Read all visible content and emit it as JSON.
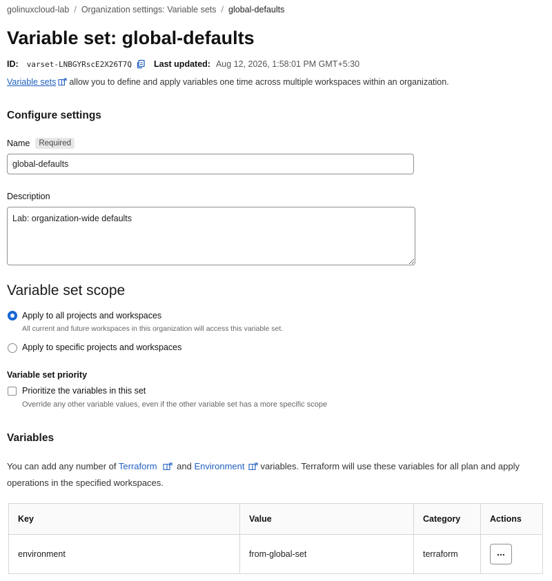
{
  "breadcrumb": {
    "items": [
      "golinuxcloud-lab",
      "Organization settings: Variable sets",
      "global-defaults"
    ]
  },
  "page": {
    "title": "Variable set: global-defaults",
    "id_label": "ID:",
    "id_value": "varset-LNBGYRscE2X26T7Q",
    "updated_label": "Last updated:",
    "updated_value": "Aug 12, 2026, 1:58:01 PM GMT+5:30",
    "intro_link": "Variable sets",
    "intro_text": "allow you to define and apply variables one time across multiple workspaces within an organization."
  },
  "settings": {
    "heading": "Configure settings",
    "name_label": "Name",
    "required_badge": "Required",
    "name_value": "global-defaults",
    "description_label": "Description",
    "description_value": "Lab: organization-wide defaults"
  },
  "scope": {
    "heading": "Variable set scope",
    "option_all": "Apply to all projects and workspaces",
    "option_all_help": "All current and future workspaces in this organization will access this variable set.",
    "option_specific": "Apply to specific projects and workspaces",
    "priority_heading": "Variable set priority",
    "priority_label": "Prioritize the variables in this set",
    "priority_help": "Override any other variable values, even if the other variable set has a more specific scope"
  },
  "variables": {
    "heading": "Variables",
    "para_1": "You can add any number of",
    "link_terraform": "Terraform",
    "para_and": "and",
    "link_environment": "Environment",
    "para_2": "variables. Terraform will use these variables for all plan and apply operations in the specified workspaces.",
    "columns": [
      "Key",
      "Value",
      "Category",
      "Actions"
    ],
    "rows": [
      {
        "key": "environment",
        "value": "from-global-set",
        "category": "terraform",
        "actions": "..."
      }
    ]
  },
  "colors": {
    "link": "#1f5fc2",
    "radio_selected": "#1766d4"
  },
  "icons": [
    "copy-icon",
    "external-link-icon"
  ]
}
